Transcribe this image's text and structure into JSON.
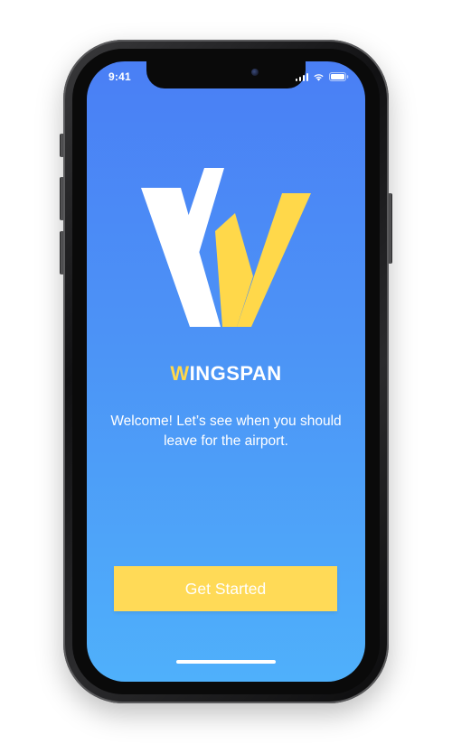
{
  "status_bar": {
    "time": "9:41",
    "icons": [
      "cellular-signal-icon",
      "wifi-icon",
      "battery-icon"
    ]
  },
  "brand": {
    "name_first_letter": "W",
    "name_rest": "INGSPAN",
    "logo_icon": "wingspan-w-logo-icon"
  },
  "welcome": {
    "message": "Welcome! Let’s see when you should leave for the airport."
  },
  "actions": {
    "get_started_label": "Get Started"
  },
  "colors": {
    "gradient_top": "#4a7ff5",
    "gradient_bottom": "#4fb0fb",
    "accent_yellow": "#ffd84a",
    "text": "#ffffff"
  }
}
